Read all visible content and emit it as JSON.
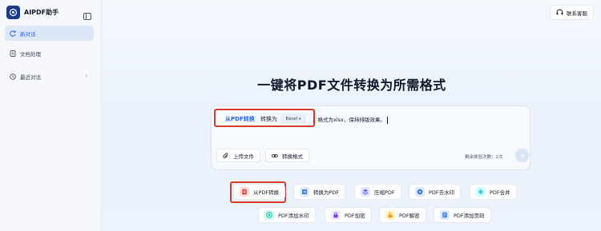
{
  "app": {
    "name": "AIPDF助手"
  },
  "sidebar": {
    "items": [
      {
        "label": "新对话",
        "icon": "new-chat-icon",
        "active": true
      },
      {
        "label": "文档处理",
        "icon": "document-icon",
        "active": false
      },
      {
        "label": "最近对话",
        "icon": "clock-icon",
        "active": false
      }
    ]
  },
  "header": {
    "support_label": "联系客服"
  },
  "main": {
    "headline": "一键将PDF文件转换为所需格式",
    "composer": {
      "from_label": "从PDF转换",
      "convert_to_label": "转换为",
      "format_value": "Excel",
      "prompt_text": "，格式为xlsx，保持排版效果。",
      "upload_label": "上传文件",
      "convert_format_label": "转换格式",
      "remaining_text": "剩余体验次数：2次"
    },
    "tools": [
      {
        "label": "从PDF转换",
        "icon": "pdf-convert-icon"
      },
      {
        "label": "转换为PDF",
        "icon": "to-pdf-icon"
      },
      {
        "label": "压缩PDF",
        "icon": "compress-icon"
      },
      {
        "label": "PDF去水印",
        "icon": "remove-watermark-icon"
      },
      {
        "label": "PDF合并",
        "icon": "merge-icon"
      },
      {
        "label": "PDF添加水印",
        "icon": "add-watermark-icon"
      },
      {
        "label": "PDF加密",
        "icon": "lock-icon"
      },
      {
        "label": "PDF解密",
        "icon": "unlock-icon"
      },
      {
        "label": "PDF添加页码",
        "icon": "page-number-icon"
      }
    ]
  },
  "colors": {
    "accent": "#2563eb",
    "highlight": "#d93b2b",
    "brand": "#1e3a8a"
  }
}
